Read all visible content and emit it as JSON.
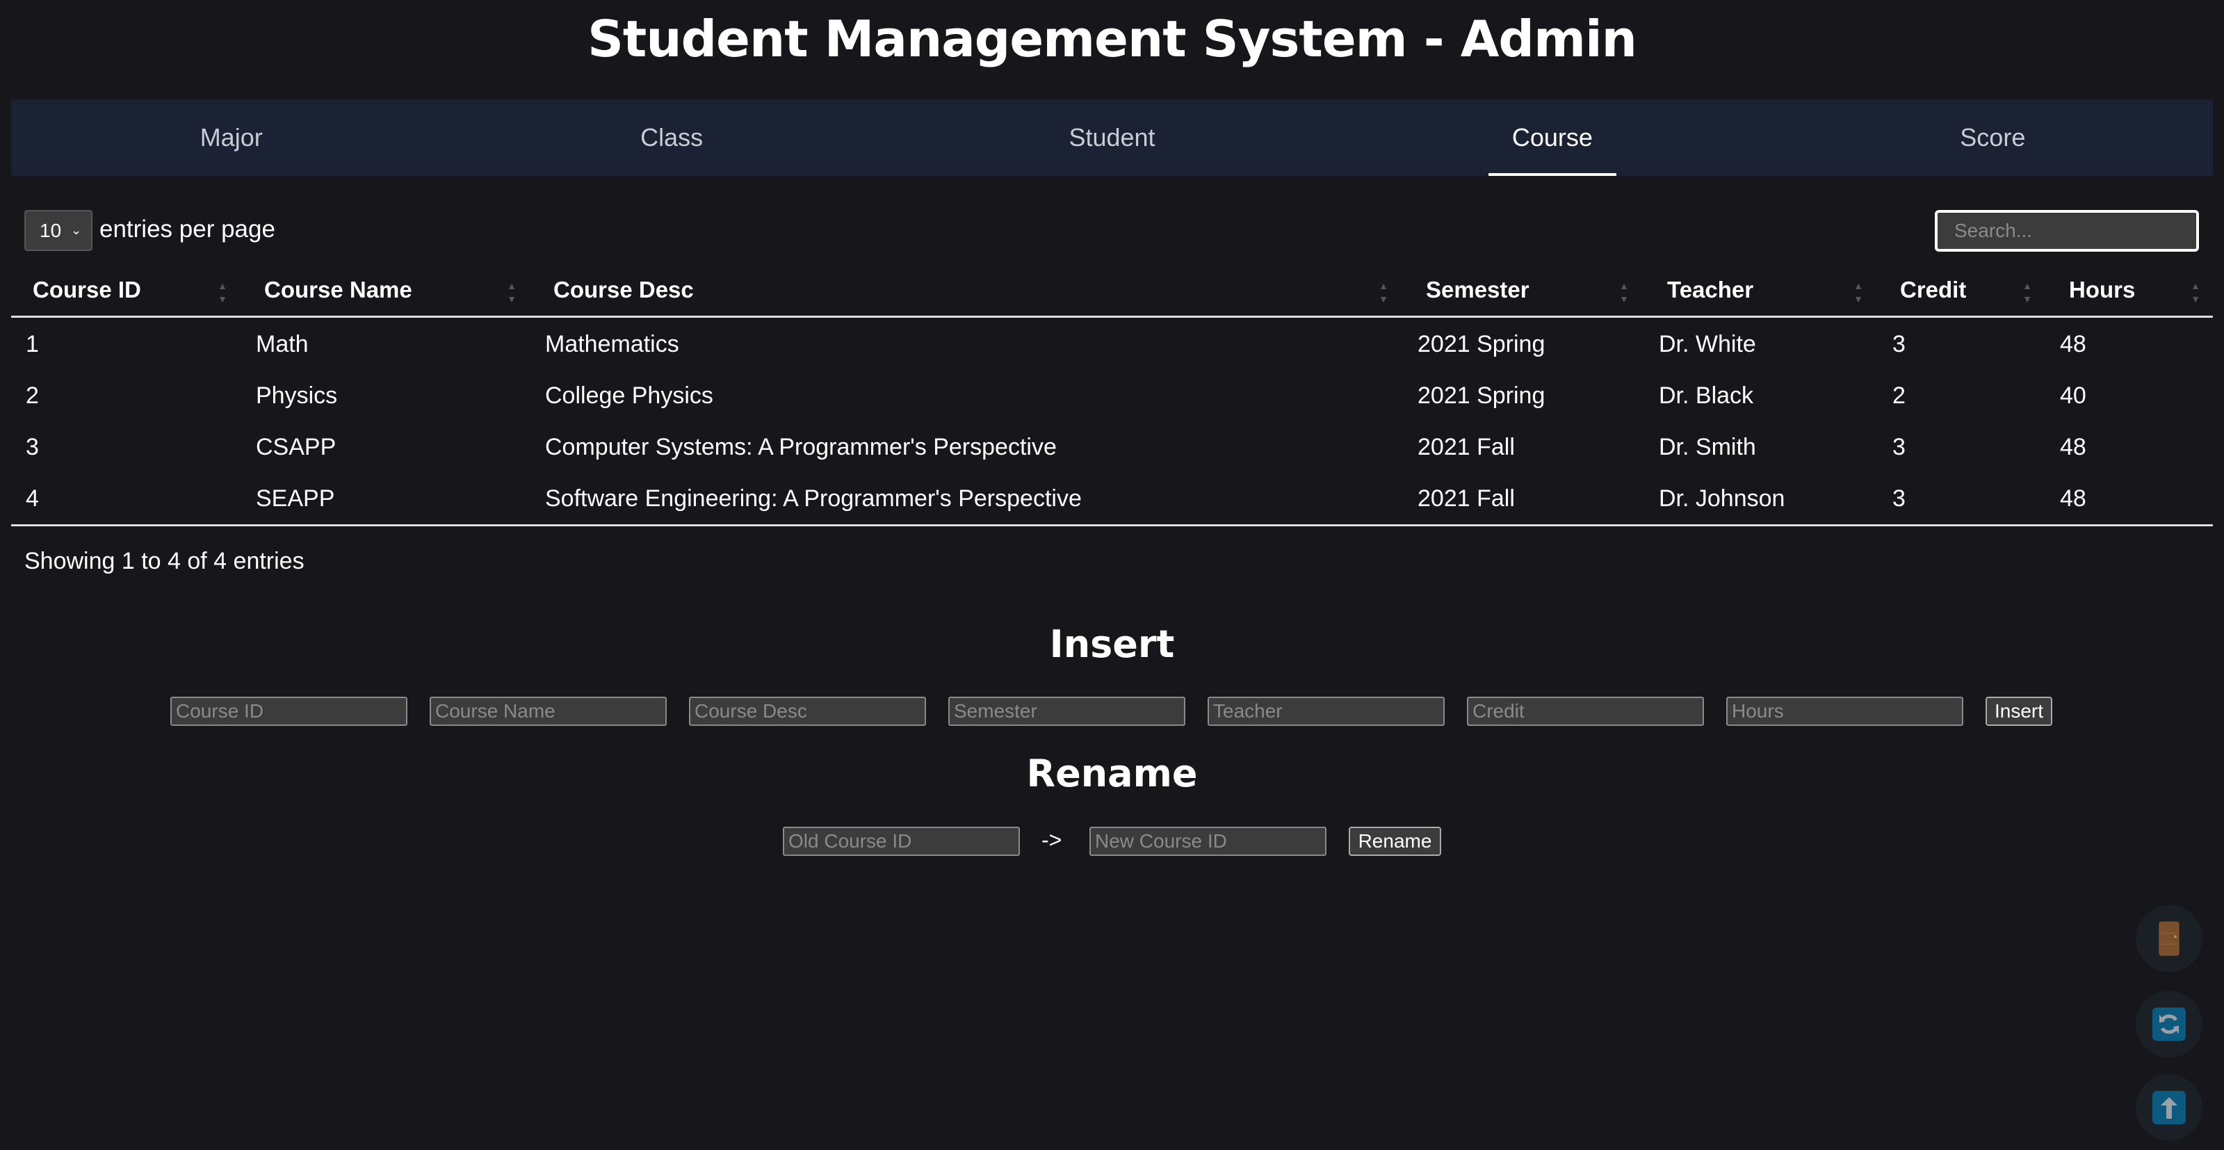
{
  "header": {
    "title": "Student Management System - Admin"
  },
  "nav": {
    "tabs": [
      "Major",
      "Class",
      "Student",
      "Course",
      "Score"
    ],
    "active": "Course"
  },
  "table_controls": {
    "page_size": "10",
    "entries_label": "entries per page",
    "search_placeholder": "Search..."
  },
  "table": {
    "columns": [
      "Course ID",
      "Course Name",
      "Course Desc",
      "Semester",
      "Teacher",
      "Credit",
      "Hours"
    ],
    "rows": [
      [
        "1",
        "Math",
        "Mathematics",
        "2021 Spring",
        "Dr. White",
        "3",
        "48"
      ],
      [
        "2",
        "Physics",
        "College Physics",
        "2021 Spring",
        "Dr. Black",
        "2",
        "40"
      ],
      [
        "3",
        "CSAPP",
        "Computer Systems: A Programmer's Perspective",
        "2021 Fall",
        "Dr. Smith",
        "3",
        "48"
      ],
      [
        "4",
        "SEAPP",
        "Software Engineering: A Programmer's Perspective",
        "2021 Fall",
        "Dr. Johnson",
        "3",
        "48"
      ]
    ],
    "info": "Showing 1 to 4 of 4 entries"
  },
  "insert": {
    "heading": "Insert",
    "placeholders": [
      "Course ID",
      "Course Name",
      "Course Desc",
      "Semester",
      "Teacher",
      "Credit",
      "Hours"
    ],
    "button": "Insert"
  },
  "rename": {
    "heading": "Rename",
    "old_placeholder": "Old Course ID",
    "arrow": "->",
    "new_placeholder": "New Course ID",
    "button": "Rename"
  },
  "floating": {
    "icons": [
      "door-icon",
      "refresh-icon",
      "arrow-up-icon"
    ]
  }
}
